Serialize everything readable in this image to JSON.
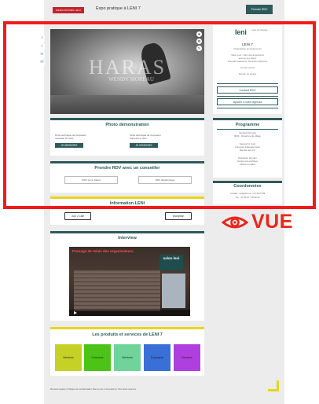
{
  "top": {
    "logo_text": "RENCONTRES LENI",
    "title": "Expo pratique à LENI 7",
    "cta": "Prendre RDV"
  },
  "social": [
    "f",
    "t",
    "in",
    "✉"
  ],
  "hero": {
    "watermark": "HARAS",
    "sub": "WENDY MOREAU",
    "icons": [
      "♥",
      "⚙",
      "✎"
    ]
  },
  "profile": {
    "logo": "leni",
    "tagline": "salon de l'élevage",
    "name": "LENI 7",
    "lines": [
      "Organisation de l'événement",
      "",
      "Salon Leni - Parc des Expositions",
      "avenue des Haras",
      "Nouvelle-Calédonie, Nouvelle-Calédonie",
      "",
      "Contact presse",
      "Dossier de presse"
    ],
    "btn_site": "Contact RDV",
    "btn_agenda": "Ajouter à votre agenda"
  },
  "programme": {
    "title": "Programme",
    "lines": [
      "Vendredi 10 mars",
      "9h00 - Ouverture du village",
      "",
      "Samedi 11 mars",
      "Concours d'élevage bovin",
      "Remise des prix",
      "",
      "Dimanche 12 mars",
      "Ventes aux enchères",
      "Clôture du salon"
    ]
  },
  "coordonnees": {
    "title": "Coordonnées",
    "lines": [
      "Contact : leni@leni.nc / 23 45 67 89",
      "Tél. : 23 45 67 / 78 90 12"
    ]
  },
  "demo": {
    "title": "Photo démonstration",
    "left_lines": [
      "Fiche technique de l'exposant",
      "Vendredi 10 mars"
    ],
    "right_lines": [
      "Fiche technique de l'exposant",
      "Samedi 11 mars"
    ],
    "left_btn": "JE M'INSCRIS",
    "right_btn": "JE M'INSCRIS"
  },
  "rdv": {
    "title": "Prendre RDV avec un conseiller",
    "left": "RDV sur le Stand",
    "right": "RDV téléphonique"
  },
  "cta": {
    "title": "Information LENI",
    "left": "Jour J Cafe",
    "right": "Inscription"
  },
  "interview": {
    "title": "Interview",
    "video_title": "Passage de relais des organisateurs",
    "video_logo": "salon leni"
  },
  "produits": {
    "title": "Les produits et services de LENI 7",
    "tiles": [
      {
        "label": "Services",
        "color": "#c6d128"
      },
      {
        "label": "Concours",
        "color": "#4cc417"
      },
      {
        "label": "Services",
        "color": "#6fd39a"
      },
      {
        "label": "Exposants",
        "color": "#3a6fd8"
      },
      {
        "label": "Services",
        "color": "#b03fe0"
      }
    ]
  },
  "footer": "Mentions légales | Politique de confidentialité | Plan du site | Informations | Tous droits réservés",
  "overlay": {
    "label": "VUE"
  },
  "colors": {
    "primary": "#2f5a5a",
    "highlight": "#f21b1b",
    "accent_yellow": "#e8d51e"
  }
}
